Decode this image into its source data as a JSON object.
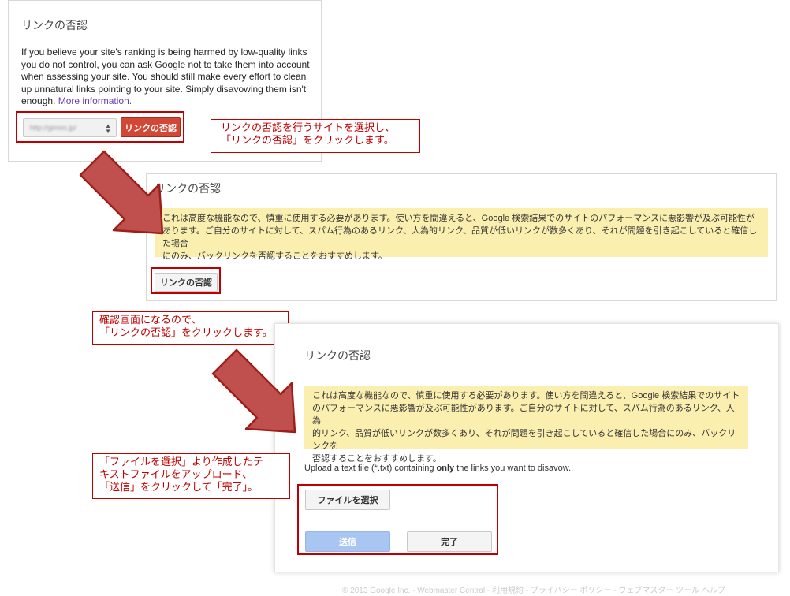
{
  "panel1": {
    "title": "リンクの否認",
    "body": "If you believe your site's ranking is being harmed by low-quality links you do not control, you can ask Google not to take them into account when assessing your site. You should still make every effort to clean up unnatural links pointing to your site. Simply disavowing them isn't enough.",
    "more_link": "More information.",
    "site_select_value": "http://gimon.jp/",
    "disavow_button": "リンクの否認"
  },
  "callout1": {
    "line1": "リンクの否認を行うサイトを選択し、",
    "line2": "「リンクの否認」をクリックします。"
  },
  "panel2": {
    "title": "リンクの否認",
    "warning": {
      "line1": "これは高度な機能なので、慎重に使用する必要があります。使い方を間違えると、Google 検索結果でのサイトのパフォーマンスに悪影響が及ぶ可能性が",
      "line2": "あります。ご自分のサイトに対して、スパム行為のあるリンク、人為的リンク、品質が低いリンクが数多くあり、それが問題を引き起こしていると確信した場合",
      "line3": "にのみ、バックリンクを否認することをおすすめします。"
    },
    "disavow_button": "リンクの否認"
  },
  "callout2": {
    "line1": "確認画面になるので、",
    "line2": "「リンクの否認」をクリックします。"
  },
  "panel3": {
    "title": "リンクの否認",
    "warning": {
      "line1": "これは高度な機能なので、慎重に使用する必要があります。使い方を間違えると、Google 検索結果でのサイト",
      "line2": "のパフォーマンスに悪影響が及ぶ可能性があります。ご自分のサイトに対して、スパム行為のあるリンク、人為",
      "line3": "的リンク、品質が低いリンクが数多くあり、それが問題を引き起こしていると確信した場合にのみ、バックリンクを",
      "line4": "否認することをおすすめします。"
    },
    "upload_prefix": "Upload a text file (*.txt) containing ",
    "upload_bold": "only",
    "upload_suffix": " the links you want to disavow.",
    "choose_file_button": "ファイルを選択",
    "submit_button": "送信",
    "done_button": "完了"
  },
  "callout3": {
    "line1": "「ファイルを選択」より作成したテ",
    "line2": "キストファイルをアップロード、",
    "line3": "「送信」をクリックして「完了」。"
  },
  "footer": "© 2013 Google Inc. - Webmaster Central - 利用規約 - プライバシー ポリシー - ウェブマスター ツール ヘルプ",
  "colors": {
    "annotation_red": "#c00000",
    "arrow_fill": "#c0504d",
    "warning_bg": "#fbefb0",
    "google_red_button": "#d14836",
    "disabled_blue_button": "#a9c6f2"
  }
}
